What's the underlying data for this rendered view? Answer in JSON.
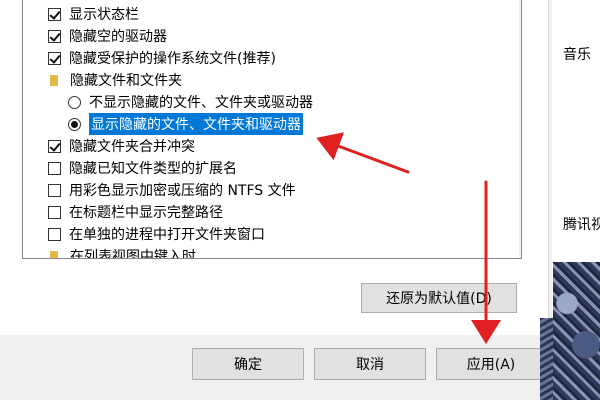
{
  "options": {
    "show_status_bar": "显示状态栏",
    "hide_empty_drives": "隐藏空的驱动器",
    "hide_protected_os_files": "隐藏受保护的操作系统文件(推荐)",
    "hidden_files_folder": "隐藏文件和文件夹",
    "radio_dont_show": "不显示隐藏的文件、文件夹或驱动器",
    "radio_show": "显示隐藏的文件、文件夹和驱动器",
    "hide_folder_merge_conflicts": "隐藏文件夹合并冲突",
    "hide_known_extensions": "隐藏已知文件类型的扩展名",
    "color_ntfs": "用彩色显示加密或压缩的 NTFS 文件",
    "full_path_title": "在标题栏中显示完整路径",
    "separate_process": "在单独的进程中打开文件夹窗口",
    "nav_pane_partial": "在列表视图中键入时"
  },
  "buttons": {
    "restore_defaults": "还原为默认值(D)",
    "ok": "确定",
    "cancel": "取消",
    "apply": "应用(A)"
  },
  "background": {
    "music_label": "音乐",
    "tencent_label": "腾讯视"
  },
  "colors": {
    "selection": "#0078d7",
    "arrow": "#e02020"
  }
}
